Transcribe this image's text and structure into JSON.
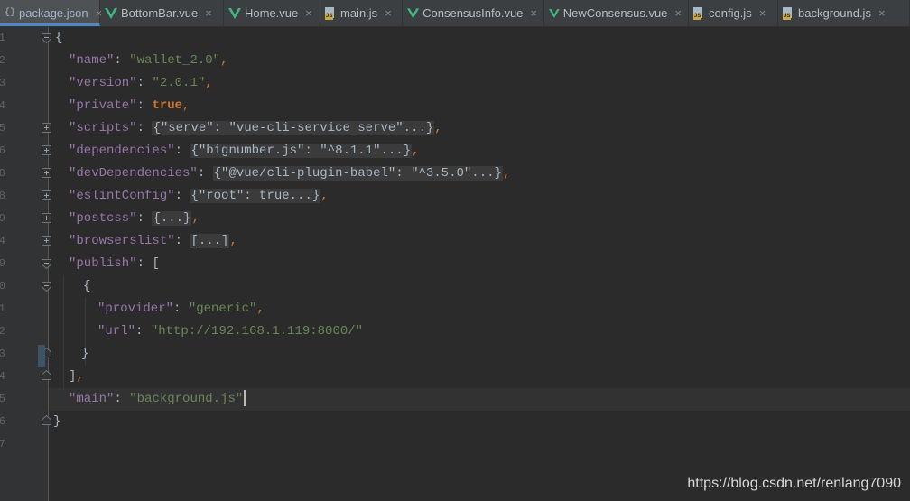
{
  "tabs": [
    {
      "name": "package.json",
      "icon": "json-file-icon",
      "active": true
    },
    {
      "name": "BottomBar.vue",
      "icon": "vue-file-icon",
      "active": false
    },
    {
      "name": "Home.vue",
      "icon": "vue-file-icon",
      "active": false
    },
    {
      "name": "main.js",
      "icon": "js-file-icon",
      "active": false
    },
    {
      "name": "ConsensusInfo.vue",
      "icon": "vue-file-icon",
      "active": false
    },
    {
      "name": "NewConsensus.vue",
      "icon": "vue-file-icon",
      "active": false
    },
    {
      "name": "config.js",
      "icon": "js-file-icon",
      "active": false
    },
    {
      "name": "background.js",
      "icon": "js-file-icon",
      "active": false
    }
  ],
  "tab_close_glyph": "×",
  "js_icon_label": "JS",
  "line_numbers": [
    "1",
    "2",
    "3",
    "4",
    "5",
    "6",
    "8",
    "8",
    "9",
    "4",
    "9",
    "0",
    "1",
    "2",
    "3",
    "4",
    "5",
    "6",
    "7"
  ],
  "code": {
    "open_brace": "{",
    "name_key": "\"name\"",
    "name_value": "\"wallet_2.0\"",
    "version_key": "\"version\"",
    "version_value": "\"2.0.1\"",
    "private_key": "\"private\"",
    "private_value": "true",
    "scripts_key": "\"scripts\"",
    "scripts_folded": "{\"serve\": \"vue-cli-service serve\"...}",
    "dependencies_key": "\"dependencies\"",
    "dependencies_folded": "{\"bignumber.js\": \"^8.1.1\"...}",
    "devDependencies_key": "\"devDependencies\"",
    "devDependencies_folded": "{\"@vue/cli-plugin-babel\": \"^3.5.0\"...}",
    "eslintConfig_key": "\"eslintConfig\"",
    "eslintConfig_folded": "{\"root\": true...}",
    "postcss_key": "\"postcss\"",
    "postcss_folded": "{...}",
    "browserslist_key": "\"browserslist\"",
    "browserslist_folded": "[...]",
    "publish_key": "\"publish\"",
    "publish_open": "[",
    "obj_open": "{",
    "provider_key": "\"provider\"",
    "provider_value": "\"generic\"",
    "url_key": "\"url\"",
    "url_value": "\"http://192.168.1.119:8000/\"",
    "obj_close": "}",
    "publish_close": "]",
    "main_key": "\"main\"",
    "main_value": "\"background.js\"",
    "close_brace": "}"
  },
  "watermark": "https://blog.csdn.net/renlang7090",
  "colors": {
    "background": "#2b2b2b",
    "key": "#9876aa",
    "string": "#6a8759",
    "keyword": "#cc7832",
    "active_tab_accent": "#4a88c7"
  }
}
